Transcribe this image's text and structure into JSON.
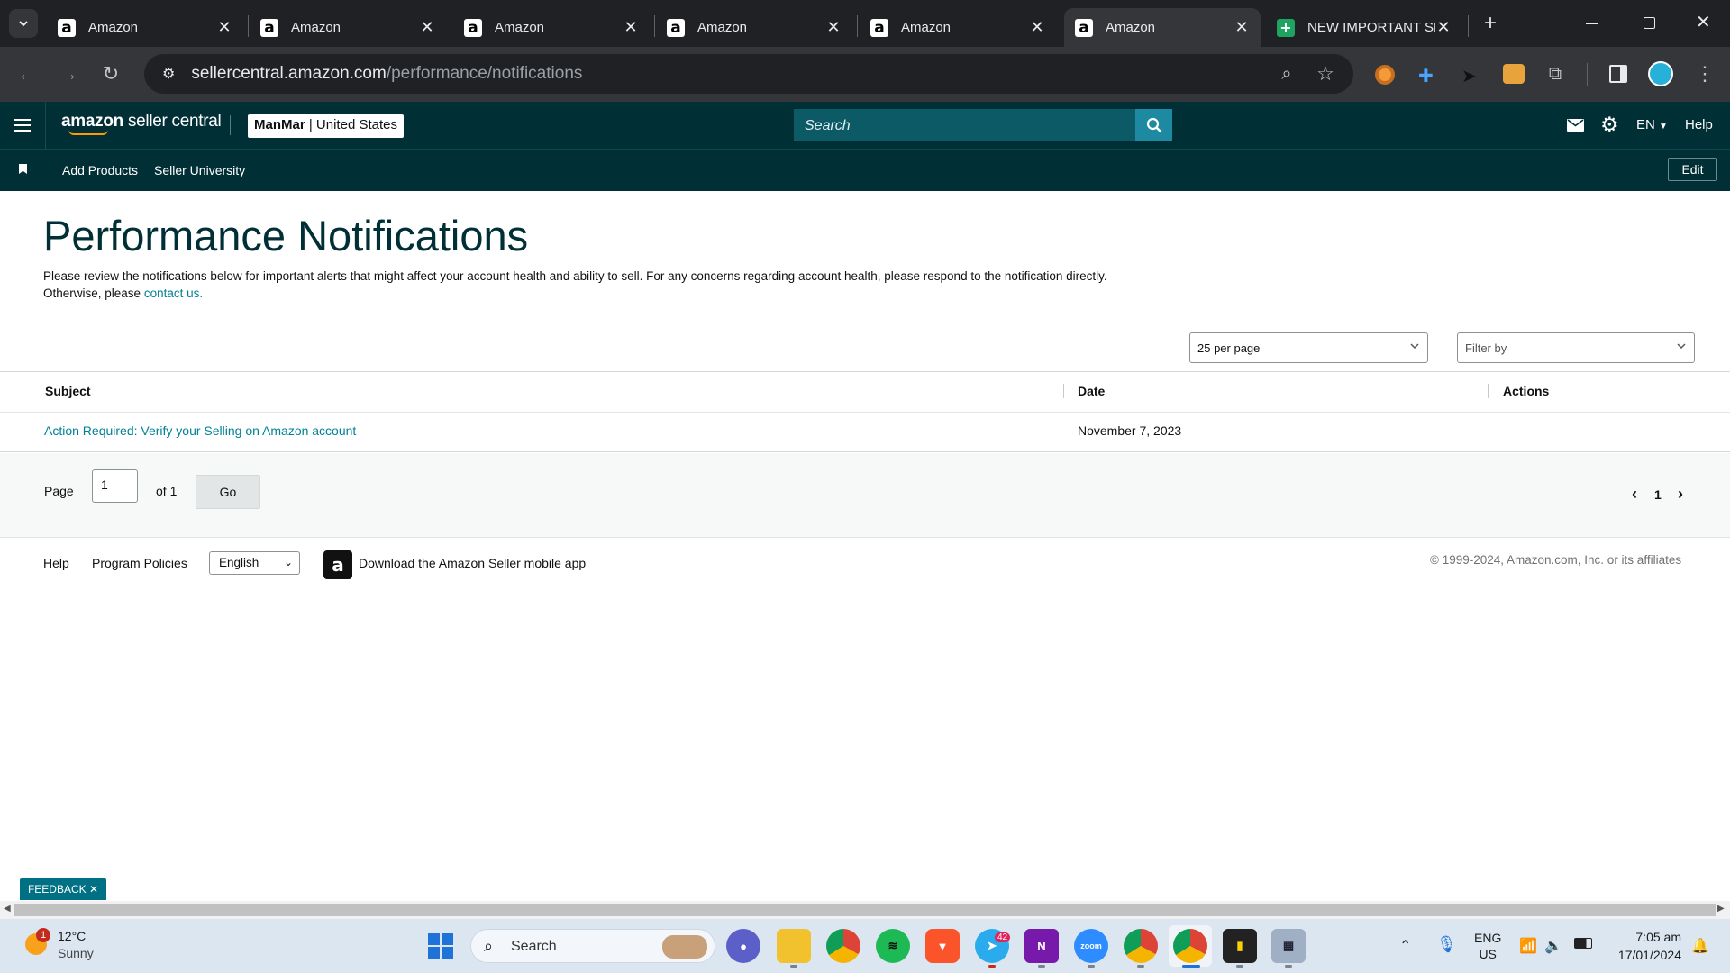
{
  "browser": {
    "tabs": [
      {
        "title": "Amazon"
      },
      {
        "title": "Amazon"
      },
      {
        "title": "Amazon"
      },
      {
        "title": "Amazon"
      },
      {
        "title": "Amazon"
      },
      {
        "title": "Amazon"
      },
      {
        "title": "NEW IMPORTANT SH"
      }
    ],
    "url_host": "sellercentral.amazon.com",
    "url_path": "/performance/notifications"
  },
  "header": {
    "logo_text": "amazon",
    "logo_suffix": "seller central",
    "account_name": "ManMar",
    "account_region": "| United States",
    "search_placeholder": "Search",
    "language": "EN",
    "help": "Help"
  },
  "subnav": {
    "items": [
      "Add Products",
      "Seller University"
    ],
    "edit": "Edit"
  },
  "main": {
    "title": "Performance Notifications",
    "description_1": "Please review the notifications below for important alerts that might affect your account health and ability to sell. For any concerns regarding account health, please respond to the notification directly.",
    "description_2_prefix": "Otherwise, please",
    "description_2_link": "contact us.",
    "per_page": "25 per page",
    "filter": "Filter by",
    "columns": [
      "Subject",
      "Date",
      "Actions"
    ],
    "rows": [
      {
        "subject": "Action Required: Verify your Selling on Amazon account",
        "date": "November 7, 2023",
        "actions": ""
      }
    ],
    "pager": {
      "page_label": "Page",
      "page_value": "1",
      "of_label": "of 1",
      "go": "Go",
      "current": "1"
    }
  },
  "footer": {
    "help": "Help",
    "policies": "Program Policies",
    "language": "English",
    "app": "Download the Amazon Seller mobile app",
    "copyright": "© 1999-2024, Amazon.com, Inc. or its affiliates",
    "feedback": "FEEDBACK"
  },
  "taskbar": {
    "weather_temp": "12°C",
    "weather_desc": "Sunny",
    "weather_badge": "1",
    "search": "Search",
    "telegram_badge": "42",
    "lang_1": "ENG",
    "lang_2": "US",
    "time": "7:05 am",
    "date": "17/01/2024"
  }
}
